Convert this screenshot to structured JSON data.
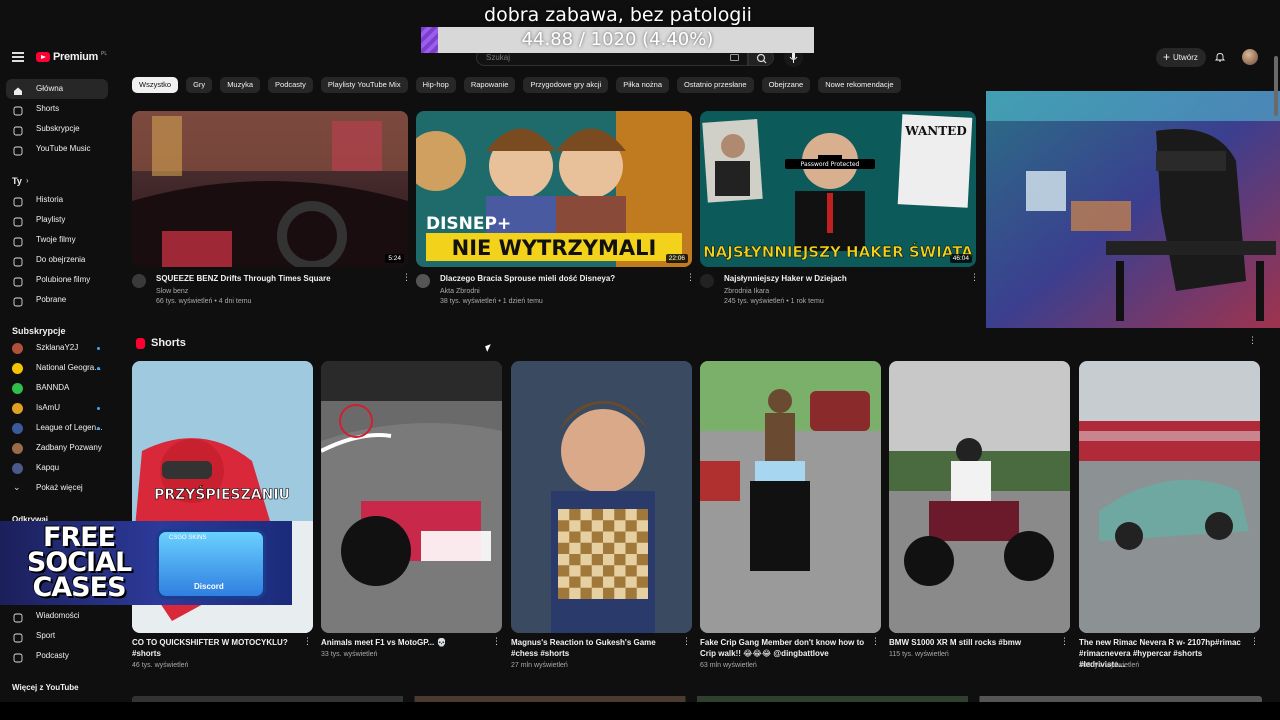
{
  "overlay": {
    "title": "dobra zabawa, bez patologii",
    "progress_text": "44.88 / 1020 (4.40%)",
    "progress_fraction": 0.044
  },
  "header": {
    "logo": "Premium",
    "logo_region": "PL",
    "search_placeholder": "Szukaj",
    "create_label": "Utwórz"
  },
  "sidebar": {
    "main": [
      {
        "label": "Główna",
        "icon": "home-icon",
        "active": true
      },
      {
        "label": "Shorts",
        "icon": "shorts-icon"
      },
      {
        "label": "Subskrypcje",
        "icon": "subscriptions-icon"
      },
      {
        "label": "YouTube Music",
        "icon": "music-icon"
      }
    ],
    "you_title": "Ty",
    "you": [
      {
        "label": "Historia",
        "icon": "history-icon"
      },
      {
        "label": "Playlisty",
        "icon": "playlist-icon"
      },
      {
        "label": "Twoje filmy",
        "icon": "your-videos-icon"
      },
      {
        "label": "Do obejrzenia",
        "icon": "watch-later-icon"
      },
      {
        "label": "Polubione filmy",
        "icon": "like-icon"
      },
      {
        "label": "Pobrane",
        "icon": "download-icon"
      }
    ],
    "subs_title": "Subskrypcje",
    "subs": [
      {
        "label": "SzklanaY2J",
        "color": "#b0503a",
        "dot": true
      },
      {
        "label": "National Geogra...",
        "color": "#f5c400",
        "dot": true
      },
      {
        "label": "BANNDA",
        "color": "#2fbf4a",
        "dot": false
      },
      {
        "label": "IsAmU",
        "color": "#e0a020",
        "dot": true
      },
      {
        "label": "League of Legen...",
        "color": "#3a5a9a",
        "dot": true
      },
      {
        "label": "Zadbany Pozwany",
        "color": "#9a6a4a",
        "dot": false
      },
      {
        "label": "Kapqu",
        "color": "#4a5a8a",
        "dot": false
      }
    ],
    "show_more": "Pokaż więcej",
    "explore_title": "Odkrywaj",
    "explore": [
      {
        "label": "Wiadomości",
        "icon": "news-icon"
      },
      {
        "label": "Sport",
        "icon": "trophy-icon"
      },
      {
        "label": "Podcasty",
        "icon": "podcast-icon"
      }
    ],
    "more_title": "Więcej z YouTube"
  },
  "chips": [
    "Wszystko",
    "Gry",
    "Muzyka",
    "Podcasty",
    "Playlisty YouTube Mix",
    "Hip-hop",
    "Rapowanie",
    "Przygodowe gry akcji",
    "Piłka nożna",
    "Ostatnio przesłane",
    "Obejrzane",
    "Nowe rekomendacje"
  ],
  "videos": [
    {
      "title": "SQUEEZE BENZ Drifts Through Times Square",
      "channel": "Slow benz",
      "stats": "66 tys. wyświetleń • 4 dni temu",
      "duration": "5:24",
      "av": "#3a3a3a"
    },
    {
      "title": "Dlaczego Bracia Sprouse mieli dość Disneya?",
      "channel": "Akta Zbrodni",
      "stats": "38 tys. wyświetleń • 1 dzień temu",
      "duration": "22:06",
      "av": "#555",
      "overlay_text": "NIE WYTRZYMALI",
      "overlay_brand": "DISNEP+"
    },
    {
      "title": "Najsłynniejszy Haker w Dziejach",
      "channel": "Zbrodnia Ikara",
      "stats": "245 tys. wyświetleń • 1 rok temu",
      "duration": "46:04",
      "av": "#222",
      "overlay_text": "NAJSŁYNNIEJSZY HAKER ŚWIATA",
      "tag": "Password Protected",
      "poster": "WANTED"
    }
  ],
  "shorts_title": "Shorts",
  "shorts": [
    {
      "title": "CO TO QUICKSHIFTER W MOTOCYKLU? #shorts",
      "views": "46 tys. wyświetleń",
      "overlay": "PRZYŚPIESZANIU"
    },
    {
      "title": "Animals meet F1 vs MotoGP... 💀",
      "views": "33 tys. wyświetleń"
    },
    {
      "title": "Magnus's Reaction to Gukesh's Game #chess #shorts",
      "views": "27 mln wyświetleń"
    },
    {
      "title": "Fake Crip Gang Member don't know how to Crip walk!! 😂😂😂 @dingbattlove",
      "views": "63 mln wyświetleń"
    },
    {
      "title": "BMW S1000 XR M still rocks #bmw",
      "views": "115 tys. wyświetleń"
    },
    {
      "title": "The new Rimac Nevera R w- 2107hp#rimac #rimacnevera #hypercar #shorts #ledriviste...",
      "views": "108 tys. wyświetleń"
    }
  ],
  "promo": {
    "text": "FREE SOCIAL CASES",
    "label": "CSGO SKINS",
    "badge": "Discord"
  }
}
